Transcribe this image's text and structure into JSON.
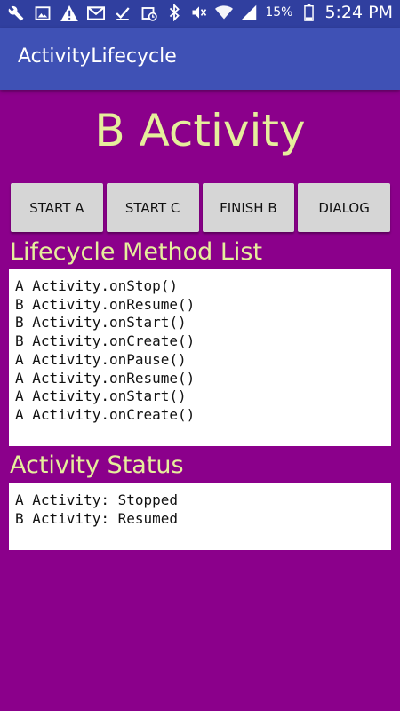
{
  "status_bar": {
    "icons": [
      "wrench-icon",
      "image-icon",
      "warning-icon",
      "gmail-icon",
      "check-icon",
      "calendar-icon",
      "bluetooth-icon",
      "mute-icon",
      "wifi-icon",
      "signal-icon"
    ],
    "battery": "15%",
    "time": "5:24 PM"
  },
  "app_bar": {
    "title": "ActivityLifecycle"
  },
  "main": {
    "heading": "B Activity",
    "buttons": [
      "START A",
      "START C",
      "FINISH B",
      "DIALOG"
    ],
    "lifecycle_title": "Lifecycle Method List",
    "lifecycle_items": [
      "A Activity.onStop()",
      "B Activity.onResume()",
      "B Activity.onStart()",
      "B Activity.onCreate()",
      "A Activity.onPause()",
      "A Activity.onResume()",
      "A Activity.onStart()",
      "A Activity.onCreate()"
    ],
    "status_title": "Activity Status",
    "status_items": [
      "A Activity: Stopped",
      "B Activity: Resumed"
    ]
  },
  "colors": {
    "background": "#8B008B",
    "app_bar": "#3F51B5",
    "status_bar": "#303F9F",
    "accent_text": "#E6EE9C"
  }
}
